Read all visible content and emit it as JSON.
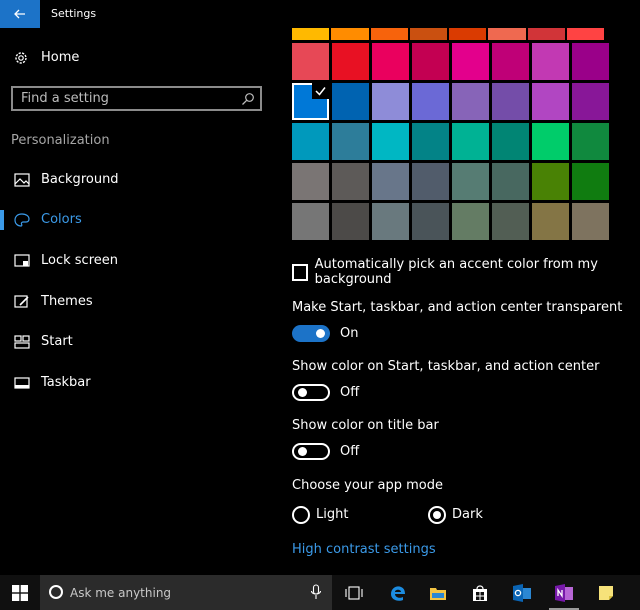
{
  "window": {
    "title": "Settings"
  },
  "sidebar": {
    "home_label": "Home",
    "search_placeholder": "Find a setting",
    "section_title": "Personalization",
    "items": [
      {
        "label": "Background",
        "icon": "picture-icon"
      },
      {
        "label": "Colors",
        "icon": "palette-icon",
        "active": true
      },
      {
        "label": "Lock screen",
        "icon": "lock-screen-icon"
      },
      {
        "label": "Themes",
        "icon": "brush-icon"
      },
      {
        "label": "Start",
        "icon": "start-layout-icon"
      },
      {
        "label": "Taskbar",
        "icon": "taskbar-icon"
      }
    ]
  },
  "colors": {
    "top_row": [
      "#ffb900",
      "#ff8c00",
      "#f7630c",
      "#ca5010",
      "#da3b01",
      "#ef6950",
      "#d13438",
      "#ff4343"
    ],
    "swatches": [
      [
        "#e74856",
        "#e81123",
        "#ea005e",
        "#c30052",
        "#e3008c",
        "#bf0077",
        "#c239b3",
        "#9a0089"
      ],
      [
        "#0078d7",
        "#0063b1",
        "#8e8cd8",
        "#6b69d6",
        "#8764b8",
        "#744da9",
        "#b146c2",
        "#881798"
      ],
      [
        "#0099bc",
        "#2d7d9a",
        "#00b7c3",
        "#038387",
        "#00b294",
        "#018574",
        "#00cc6a",
        "#10893e"
      ],
      [
        "#7a7574",
        "#5d5a58",
        "#68768a",
        "#515c6b",
        "#567c73",
        "#486860",
        "#498205",
        "#107c10"
      ],
      [
        "#767676",
        "#4c4a48",
        "#69797e",
        "#4a5459",
        "#647c64",
        "#525e54",
        "#847545",
        "#7e735f"
      ]
    ],
    "selected": "#0078d7",
    "accent": "#1c73c8",
    "link": "#3b9ae8"
  },
  "settings": {
    "auto_pick_label": "Automatically pick an accent color from my background",
    "auto_pick_checked": false,
    "transparent_label": "Make Start, taskbar, and action center transparent",
    "transparent_state": "On",
    "show_color_start_label": "Show color on Start, taskbar, and action center",
    "show_color_start_state": "Off",
    "show_color_title_label": "Show color on title bar",
    "show_color_title_state": "Off",
    "app_mode_label": "Choose your app mode",
    "app_mode_light": "Light",
    "app_mode_dark": "Dark",
    "app_mode_selected": "Dark",
    "high_contrast_link": "High contrast settings"
  },
  "taskbar": {
    "search_placeholder": "Ask me anything",
    "icons": [
      "start-icon",
      "cortana-icon",
      "microphone-icon",
      "task-view-icon",
      "edge-icon",
      "file-explorer-icon",
      "store-icon",
      "outlook-icon",
      "onenote-icon",
      "sticky-notes-icon"
    ]
  }
}
